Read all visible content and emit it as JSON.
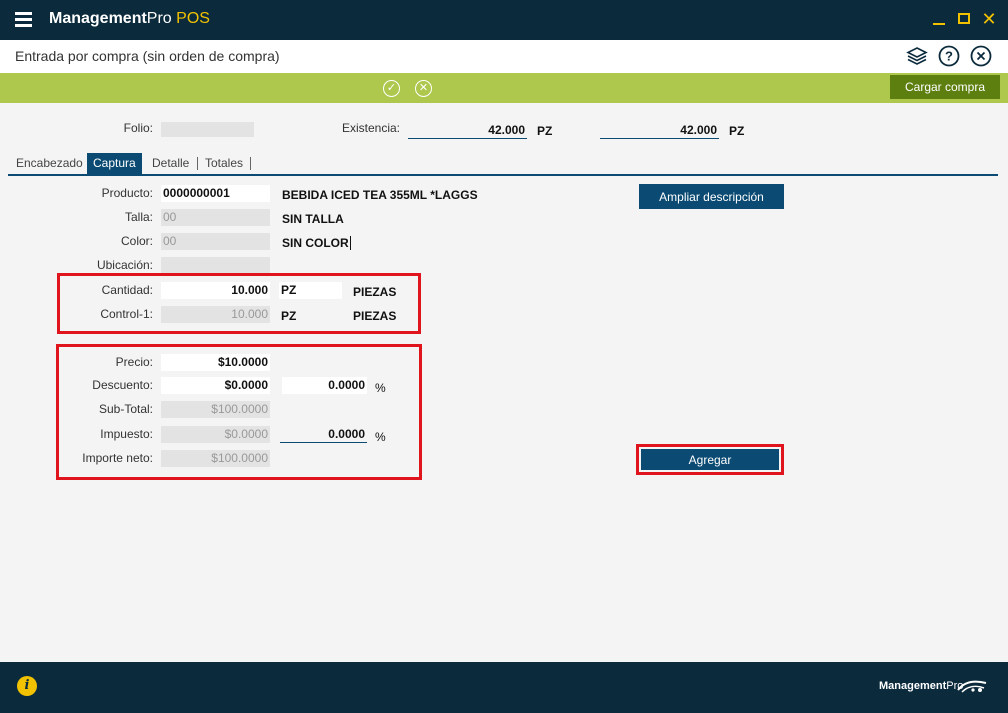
{
  "titlebar": {
    "app_name": "Management",
    "app_name_b": "Pro",
    "app_suffix": " POS"
  },
  "page_title": "Entrada por compra (sin orden de compra)",
  "actionbar": {
    "load_button": "Cargar compra",
    "confirm_glyph": "✓",
    "cancel_glyph": "✕"
  },
  "header_fields": {
    "folio_label": "Folio:",
    "folio_value": "",
    "existencia_label": "Existencia:",
    "existencia_1": "42.000",
    "unit_1": "PZ",
    "existencia_2": "42.000",
    "unit_2": "PZ"
  },
  "tabs": [
    "Encabezado",
    "Captura",
    "Detalle",
    "Totales"
  ],
  "active_tab": "Captura",
  "product": {
    "producto_label": "Producto:",
    "producto_code": "0000000001",
    "producto_desc": "BEBIDA ICED TEA 355ML *LAGGS",
    "talla_label": "Talla:",
    "talla_code": "00",
    "talla_desc": "SIN TALLA",
    "color_label": "Color:",
    "color_code": "00",
    "color_desc": "SIN COLOR",
    "ubicacion_label": "Ubicación:",
    "ubicacion_value": ""
  },
  "quantity": {
    "cantidad_label": "Cantidad:",
    "cantidad_value": "10.000",
    "cantidad_unit": "PZ",
    "cantidad_unit_desc": "PIEZAS",
    "control_label": "Control-1:",
    "control_value": "10.000",
    "control_unit": "PZ",
    "control_unit_desc": "PIEZAS"
  },
  "pricing": {
    "precio_label": "Precio:",
    "precio_value": "$10.0000",
    "descuento_label": "Descuento:",
    "descuento_value": "$0.0000",
    "descuento_pct": "0.0000",
    "pct_sign": "%",
    "subtotal_label": "Sub-Total:",
    "subtotal_value": "$100.0000",
    "impuesto_label": "Impuesto:",
    "impuesto_value": "$0.0000",
    "impuesto_pct": "0.0000",
    "importe_label": "Importe neto:",
    "importe_value": "$100.0000"
  },
  "buttons": {
    "ampliar": "Ampliar descripción",
    "agregar": "Agregar"
  },
  "footer": {
    "brand_a": "Management",
    "brand_b": "Pro",
    "info_glyph": "i"
  },
  "colors": {
    "navy": "#0b2a3c",
    "blue": "#0b4a72",
    "green": "#aec84e",
    "dark_green": "#5d7f0f",
    "yellow": "#f2c200",
    "highlight_red": "#e0141c"
  }
}
